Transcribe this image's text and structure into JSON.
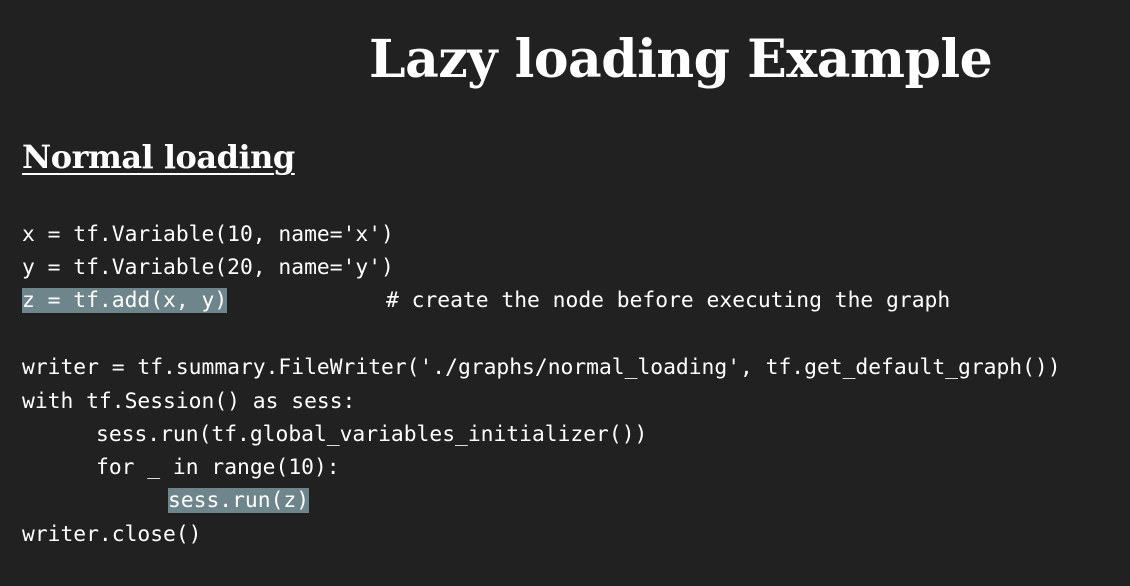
{
  "slide": {
    "title": "Lazy loading Example",
    "subtitle": "Normal loading"
  },
  "code": {
    "line1": "x = tf.Variable(10, name='x')",
    "line2": "y = tf.Variable(20, name='y')",
    "line3": "z = tf.add(x, y)",
    "line3_comment": "# create the node before executing the graph",
    "line5": "writer = tf.summary.FileWriter('./graphs/normal_loading', tf.get_default_graph())",
    "line6": "with tf.Session() as sess:",
    "line7": "sess.run(tf.global_variables_initializer())",
    "line8": "for _ in range(10):",
    "line9": "sess.run(z)",
    "line10": "writer.close()"
  },
  "colors": {
    "background": "#212121",
    "text": "#ffffff",
    "highlight": "#6e858c"
  }
}
